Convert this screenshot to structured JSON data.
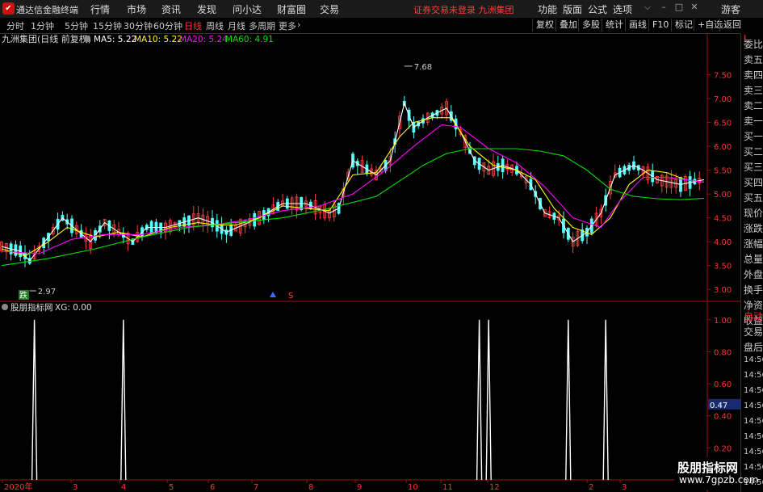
{
  "app": {
    "logo_glyph": "✔",
    "name": "通达信金融终端"
  },
  "menu": [
    "行情",
    "市场",
    "资讯",
    "发现",
    "问小达",
    "财富圈",
    "交易"
  ],
  "notice": "证券交易未登录  九洲集团",
  "right_menu": [
    "功能",
    "版面",
    "公式",
    "选项"
  ],
  "guest": "游客",
  "periods": [
    "分时",
    "1分钟",
    "5分钟",
    "15分钟",
    "30分钟",
    "60分钟",
    "日线",
    "周线",
    "月线",
    "多周期",
    "更多"
  ],
  "active_period": "日线",
  "right_tools": [
    "复权",
    "叠加",
    "多股",
    "统计",
    "画线",
    "F10",
    "标记",
    "+自选",
    "返回"
  ],
  "stock_label": "九洲集团(日线 前复权)",
  "ma": [
    {
      "label": "MA5: 5.22",
      "color": "#ffffff"
    },
    {
      "label": "MA10: 5.22",
      "color": "#ffff00"
    },
    {
      "label": "MA20: 5.24",
      "color": "#ff00ff"
    },
    {
      "label": "MA60: 4.91",
      "color": "#00e000"
    }
  ],
  "main_axis": {
    "ticks": [
      7.5,
      7.0,
      6.5,
      6.0,
      5.5,
      5.0,
      4.5,
      4.0,
      3.5,
      3.0
    ],
    "labels": [
      "7.50",
      "7.00",
      "6.50",
      "6.00",
      "5.50",
      "5.00",
      "4.50",
      "4.00",
      "3.50",
      "3.00"
    ],
    "min": 2.75,
    "max": 8.0
  },
  "annotations": {
    "high": "7.68",
    "high_value": 7.68,
    "low": "2.97",
    "low_value": 2.97,
    "die_label": "跌"
  },
  "indicator": {
    "label": "股朋指标网",
    "value_label": "XG: 0.00"
  },
  "sub_axis": {
    "ticks": [
      1.0,
      0.8,
      0.6,
      0.4,
      0.2
    ],
    "labels": [
      "1.00",
      "0.80",
      "0.60",
      "0.40",
      "0.20"
    ],
    "current": "0.47"
  },
  "date_labels": [
    "2020年",
    "3",
    "4",
    "5",
    "6",
    "7",
    "8",
    "9",
    "10",
    "11",
    "12",
    "2",
    "3"
  ],
  "sidebar_top": "L",
  "sidebar_items": [
    "委比",
    "卖五",
    "卖四",
    "卖三",
    "卖二",
    "卖一",
    "买一",
    "买二",
    "买三",
    "买四",
    "买五",
    "现价",
    "涨跌",
    "涨幅",
    "总量",
    "外盘",
    "换手",
    "净资",
    "收益"
  ],
  "sidebar_lower": [
    "自动",
    "交易",
    "盘后",
    "14:56",
    "14:56",
    "14:56",
    "14:56",
    "14:56",
    "14:56",
    "14:56",
    "14:56",
    "14:56"
  ],
  "watermark": {
    "title": "股朋指标网",
    "url": "www.7gpzb.com"
  },
  "chart_data": {
    "type": "line",
    "series": [
      {
        "name": "MA5",
        "color": "#ffffff",
        "x": [
          0,
          4,
          6,
          10,
          13,
          19,
          22,
          28,
          31,
          35,
          42,
          45,
          48,
          55,
          60,
          65,
          70,
          72,
          75,
          80,
          83,
          86,
          88,
          91,
          95,
          98,
          101,
          104,
          107,
          110,
          113,
          116,
          119,
          122,
          125,
          128,
          131,
          135,
          137,
          140,
          145,
          150
        ],
        "y": [
          3.9,
          3.8,
          3.6,
          4.1,
          4.5,
          4.0,
          4.4,
          4.0,
          4.3,
          4.3,
          4.5,
          4.4,
          4.2,
          4.5,
          4.8,
          4.8,
          4.6,
          4.7,
          5.7,
          5.4,
          5.7,
          6.9,
          6.4,
          6.6,
          6.8,
          6.3,
          5.7,
          5.5,
          5.6,
          5.5,
          5.2,
          4.6,
          4.5,
          4.0,
          4.2,
          4.6,
          5.4,
          5.6,
          5.5,
          5.3,
          5.2,
          5.3
        ]
      },
      {
        "name": "MA10",
        "color": "#ffff00",
        "x": [
          0,
          5,
          10,
          14,
          20,
          25,
          30,
          36,
          42,
          46,
          50,
          55,
          60,
          65,
          70,
          75,
          80,
          85,
          88,
          92,
          96,
          100,
          105,
          110,
          114,
          118,
          122,
          126,
          130,
          134,
          138,
          142,
          146,
          150
        ],
        "y": [
          3.85,
          3.7,
          4.0,
          4.3,
          4.1,
          4.2,
          4.1,
          4.3,
          4.4,
          4.35,
          4.35,
          4.5,
          4.75,
          4.7,
          4.65,
          5.4,
          5.45,
          6.2,
          6.5,
          6.6,
          6.6,
          6.0,
          5.6,
          5.5,
          5.3,
          4.7,
          4.3,
          4.15,
          4.5,
          5.2,
          5.5,
          5.45,
          5.3,
          5.25
        ]
      },
      {
        "name": "MA20",
        "color": "#ff00ff",
        "x": [
          0,
          8,
          15,
          22,
          30,
          38,
          45,
          52,
          60,
          68,
          75,
          82,
          88,
          94,
          98,
          104,
          110,
          116,
          122,
          128,
          132,
          137,
          142,
          150
        ],
        "y": [
          3.8,
          3.75,
          4.05,
          4.15,
          4.15,
          4.3,
          4.35,
          4.45,
          4.65,
          4.75,
          5.0,
          5.5,
          6.0,
          6.45,
          6.4,
          5.95,
          5.65,
          5.15,
          4.5,
          4.3,
          4.85,
          5.35,
          5.35,
          5.25
        ]
      },
      {
        "name": "MA60",
        "color": "#00e000",
        "x": [
          0,
          10,
          20,
          30,
          40,
          50,
          60,
          70,
          80,
          90,
          95,
          100,
          105,
          110,
          115,
          120,
          125,
          130,
          135,
          140,
          145,
          150
        ],
        "y": [
          3.5,
          3.65,
          3.85,
          4.1,
          4.3,
          4.4,
          4.5,
          4.7,
          4.95,
          5.6,
          5.85,
          5.95,
          5.95,
          5.95,
          5.9,
          5.8,
          5.5,
          5.1,
          4.95,
          4.9,
          4.88,
          4.91
        ]
      }
    ],
    "ylim": [
      2.75,
      8.0
    ],
    "signals_x": [
      7,
      26,
      102,
      104,
      121,
      129
    ],
    "signal_value": 1.0,
    "sub_ylim": [
      0,
      1.1
    ]
  }
}
